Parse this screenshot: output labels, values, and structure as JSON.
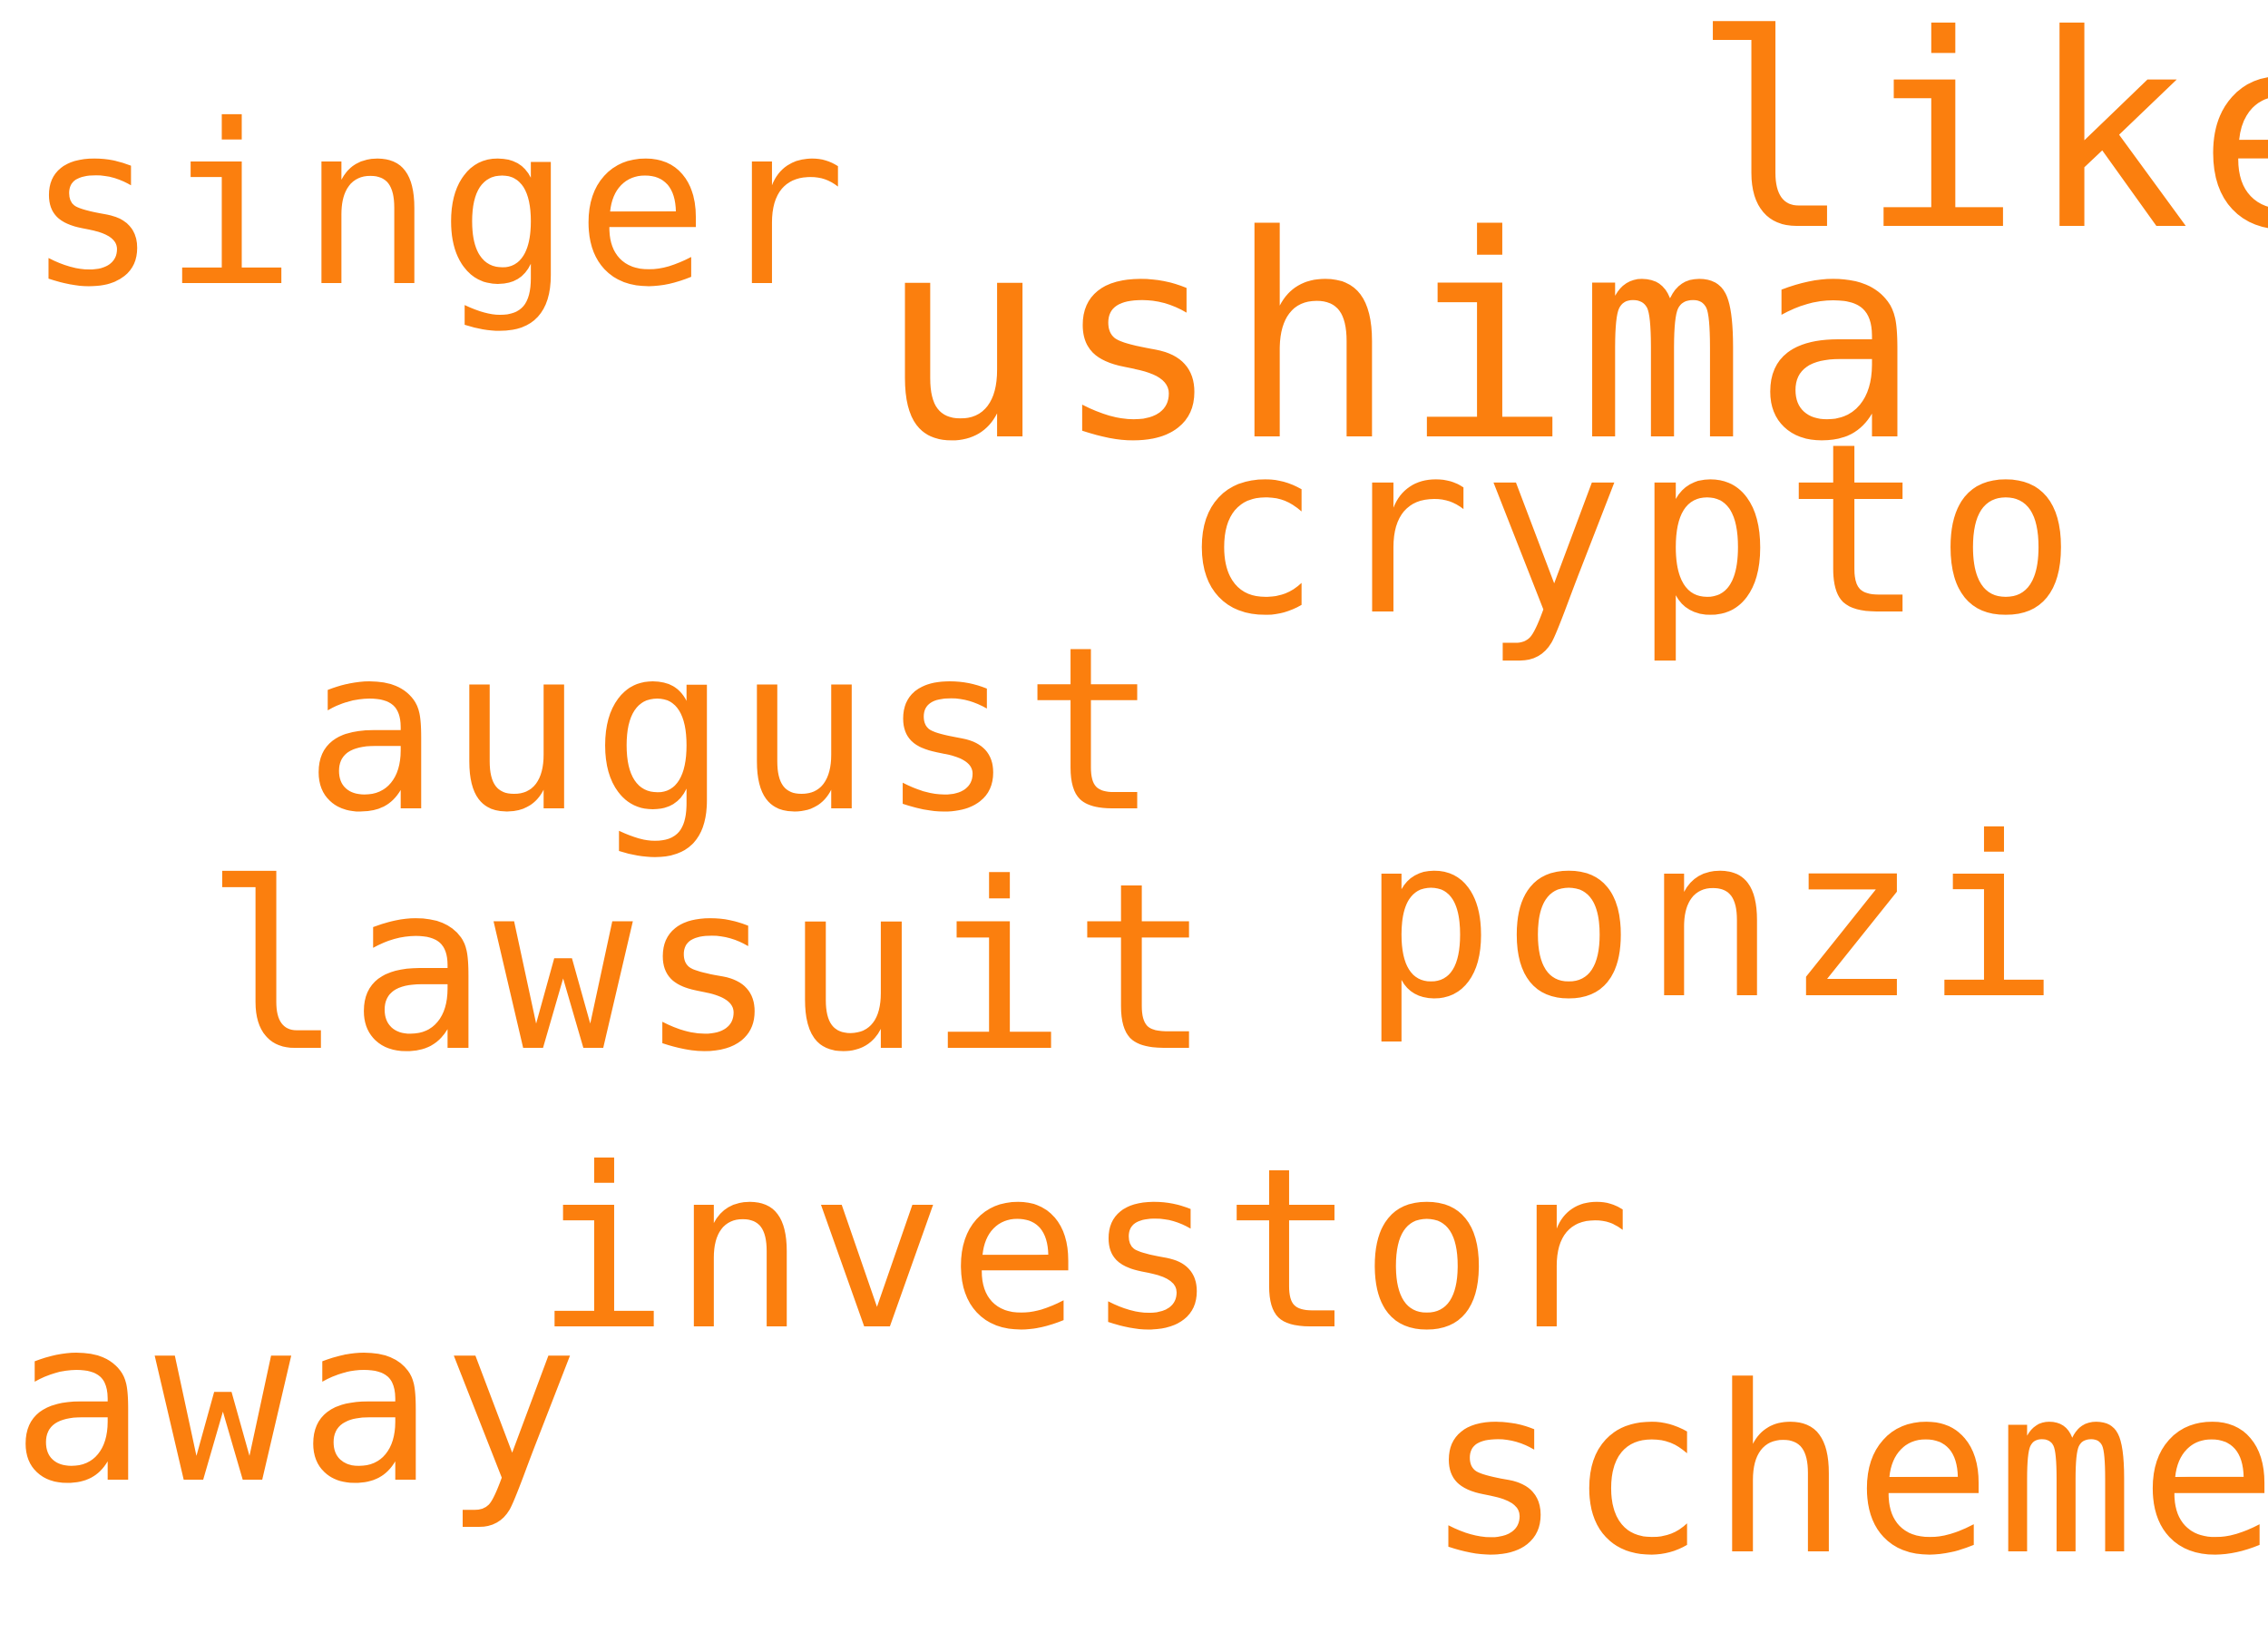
{
  "colors": {
    "background": "#ffffff",
    "word": "#fb7f0e"
  },
  "words": {
    "like": "like",
    "singer": "singer",
    "ushima": "ushima",
    "crypto": "crypto",
    "august": "august",
    "ponzi": "ponzi",
    "lawsuit": "lawsuit",
    "investor": "investor",
    "away": "away",
    "scheme": "scheme"
  }
}
